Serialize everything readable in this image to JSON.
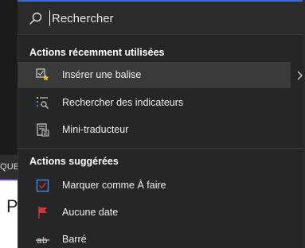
{
  "search": {
    "placeholder": "Rechercher",
    "icon": "search-icon"
  },
  "recent": {
    "title": "Actions récemment utilisées",
    "items": [
      {
        "label": "Insérer une balise",
        "icon": "tag-star-icon"
      },
      {
        "label": "Rechercher des indicateurs",
        "icon": "search-list-icon"
      },
      {
        "label": "Mini-traducteur",
        "icon": "translate-icon"
      }
    ]
  },
  "suggested": {
    "title": "Actions suggérées",
    "items": [
      {
        "label": "Marquer comme À faire",
        "icon": "checkbox-icon"
      },
      {
        "label": "Aucune date",
        "icon": "flag-icon"
      },
      {
        "label": "Barré",
        "icon": "strikethrough-icon"
      }
    ]
  },
  "background": {
    "ribbon_text": "QUE",
    "doc_letter": "P"
  },
  "colors": {
    "accent": "#3b6fd8",
    "flag": "#d13438",
    "checkbox": "#4a90e2",
    "star": "#f2c811"
  }
}
